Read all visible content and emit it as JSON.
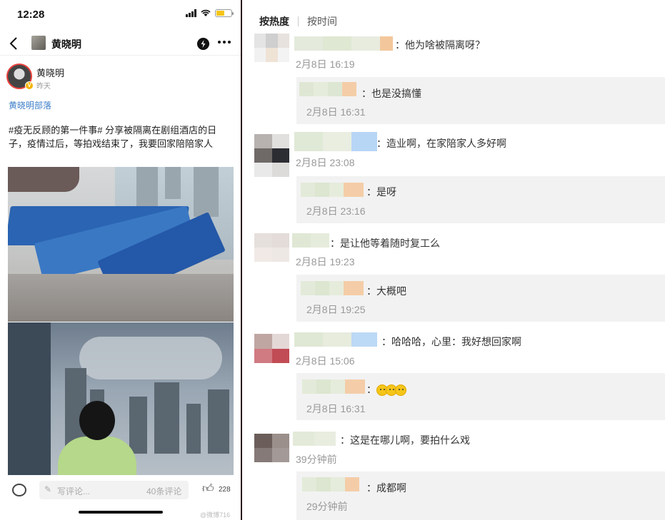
{
  "status": {
    "time": "12:28"
  },
  "nav": {
    "title": "黄晓明"
  },
  "post": {
    "author": "黄晓明",
    "time": "昨天",
    "tribe": "黄晓明部落",
    "text": "#疫无反顾的第一件事# 分享被隔离在剧组酒店的日子，疫情过后，等拍戏结束了，我要回家陪陪家人"
  },
  "bottom_bar": {
    "comment_placeholder": "写评论...",
    "comment_count": "40条评论",
    "like_count": "228",
    "watermark": "@微博716"
  },
  "sort": {
    "hot": "按热度",
    "time": "按时间"
  },
  "comments": [
    {
      "text": "：他为啥被隔离呀？",
      "date": "2月8日 16:19",
      "reply": {
        "text": "：也是没搞懂",
        "date": "2月8日 16:31"
      }
    },
    {
      "text": "：造业啊，在家陪家人多好啊",
      "date": "2月8日 23:08",
      "reply": {
        "text": "：是呀",
        "date": "2月8日 23:16"
      }
    },
    {
      "text": "：是让他等着随时复工么",
      "date": "2月8日 19:23",
      "reply": {
        "text": "：大概吧",
        "date": "2月8日 19:25"
      }
    },
    {
      "text": "：哈哈哈，心里：我好想回家啊",
      "date": "2月8日 15:06",
      "reply": {
        "text": "：",
        "date": "2月8日 16:31",
        "emoji_count": 3
      }
    },
    {
      "text": "：这是在哪儿啊，要拍什么戏",
      "date": "39分钟前",
      "reply": {
        "text": "：成都啊",
        "date": "29分钟前"
      }
    }
  ],
  "colors": {
    "accent_link": "#3d7ec8",
    "verified_badge": "#f5b400",
    "avatar_ring": "#e8413c",
    "reply_bg": "#f2f2f2"
  }
}
